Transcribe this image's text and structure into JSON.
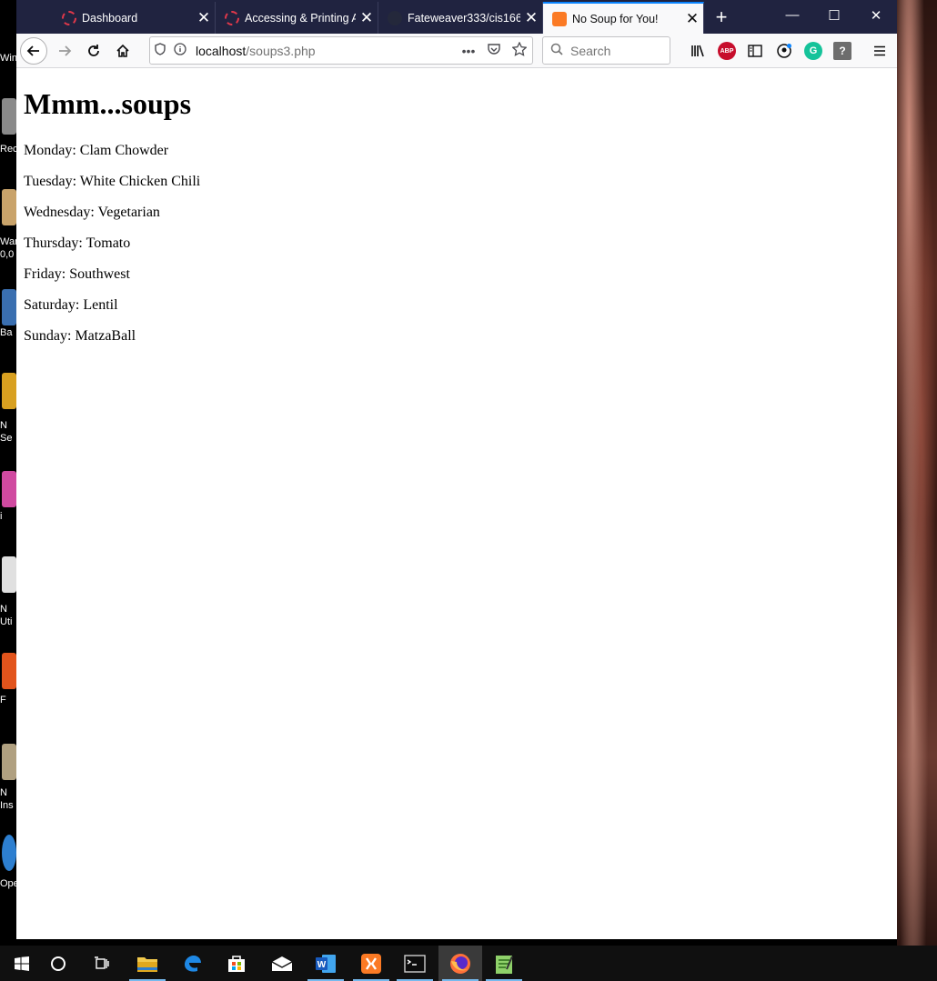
{
  "browser": {
    "tabs": [
      {
        "title": "Dashboard",
        "favicon": "spinner-icon"
      },
      {
        "title": "Accessing & Printing A",
        "favicon": "spinner-icon"
      },
      {
        "title": "Fateweaver333/cis166",
        "favicon": "github-icon"
      },
      {
        "title": "No Soup for You!",
        "favicon": "xampp-icon",
        "active": true
      }
    ],
    "new_tab_label": "+",
    "close_label": "✕",
    "window_controls": {
      "minimize": "—",
      "maximize": "☐",
      "close": "✕"
    }
  },
  "navbar": {
    "url_host": "localhost",
    "url_path": "/soups3.php",
    "more_label": "•••",
    "search_placeholder": "Search",
    "abp_label": "ABP",
    "grammarly_label": "G",
    "help_label": "?"
  },
  "page": {
    "heading": "Mmm...soups",
    "soups": [
      "Monday: Clam Chowder",
      "Tuesday: White Chicken Chili",
      "Wednesday: Vegetarian",
      "Thursday: Tomato",
      "Friday: Southwest",
      "Saturday: Lentil",
      "Sunday: MatzaBall"
    ]
  },
  "desktop": {
    "labels": [
      "Win",
      "Rec",
      "War",
      "0,0",
      "Ba",
      "N",
      "Se",
      "i",
      "N",
      "Uti",
      "F",
      "N",
      "Ins",
      "Ope"
    ]
  },
  "taskbar": {
    "items": [
      "windows-start-icon",
      "cortana-icon",
      "task-view-icon",
      "file-explorer-icon",
      "edge-icon",
      "store-icon",
      "mail-icon",
      "word-icon",
      "xampp-icon",
      "terminal-icon",
      "firefox-icon",
      "notepad-icon"
    ],
    "word_label": "W"
  },
  "colors": {
    "tabbar": "#202340",
    "active_tab_accent": "#0a84ff",
    "taskbar": "#101010"
  }
}
